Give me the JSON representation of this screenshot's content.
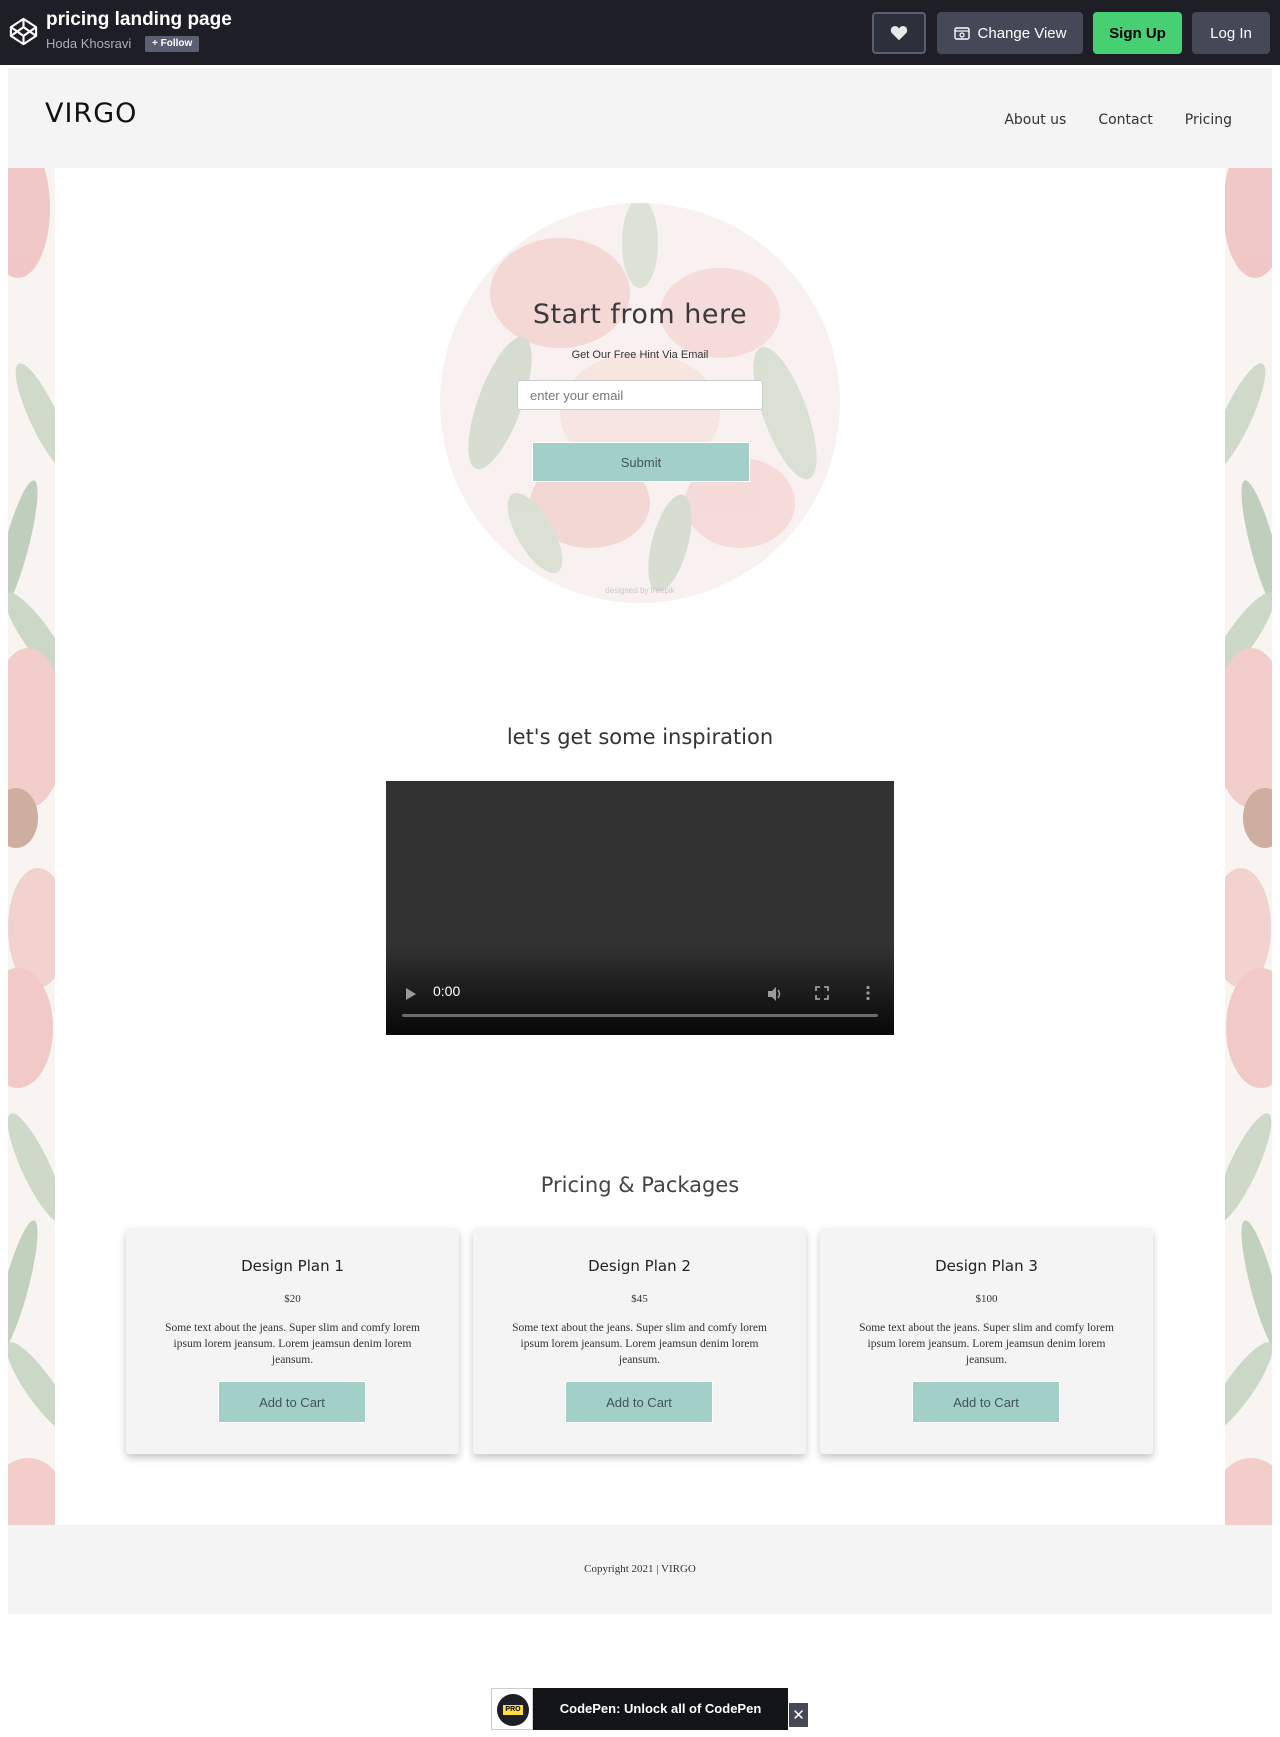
{
  "codepen": {
    "title": "pricing landing page",
    "author": "Hoda Khosravi",
    "follow_label": "+ Follow",
    "change_view_label": "Change View",
    "signup_label": "Sign Up",
    "login_label": "Log In",
    "pro_banner_label": "CodePen: Unlock all of CodePen",
    "pro_badge": "PRO",
    "close_glyph": "✕"
  },
  "site": {
    "logo": "VIRGO",
    "nav": [
      {
        "label": "About us"
      },
      {
        "label": "Contact"
      },
      {
        "label": "Pricing"
      }
    ]
  },
  "hero": {
    "title": "Start from here",
    "subtitle": "Get Our Free Hint Via Email",
    "email_placeholder": "enter your email",
    "submit_label": "Submit",
    "credit": "designed by  freepik"
  },
  "inspiration": {
    "title": "let's get some inspiration",
    "video_time": "0:00"
  },
  "pricing": {
    "title": "Pricing & Packages",
    "plans": [
      {
        "name": "Design Plan 1",
        "price": "$20",
        "description": "Some text about the jeans. Super slim and comfy lorem ipsum lorem jeansum. Lorem jeamsun denim lorem jeansum.",
        "button": "Add to Cart"
      },
      {
        "name": "Design Plan 2",
        "price": "$45",
        "description": "Some text about the jeans. Super slim and comfy lorem ipsum lorem jeansum. Lorem jeamsun denim lorem jeansum.",
        "button": "Add to Cart"
      },
      {
        "name": "Design Plan 3",
        "price": "$100",
        "description": "Some text about the jeans. Super slim and comfy lorem ipsum lorem jeansum. Lorem jeamsun denim lorem jeansum.",
        "button": "Add to Cart"
      }
    ]
  },
  "footer": {
    "copyright": "Copyright 2021 | VIRGO"
  },
  "colors": {
    "accent": "#a3cfc9",
    "codepen_bar": "#1e1f26",
    "signup_green": "#47cf73",
    "panel_grey": "#f4f4f4"
  },
  "icons": [
    "codepen-logo-icon",
    "heart-icon",
    "eye-window-icon",
    "play-icon",
    "volume-icon",
    "fullscreen-icon",
    "more-vertical-icon",
    "close-icon"
  ]
}
